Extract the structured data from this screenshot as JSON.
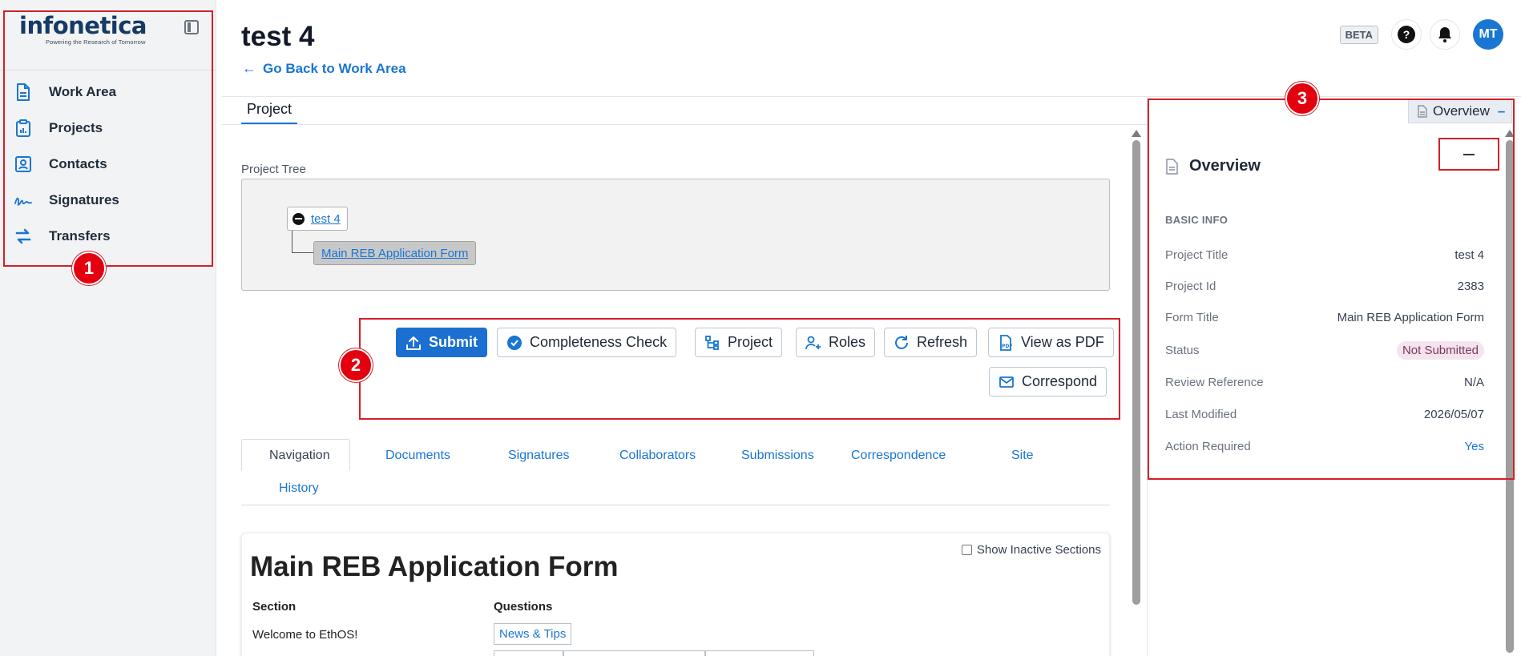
{
  "brand": {
    "name": "infonetica",
    "tagline": "Powering the Research of Tomorrow"
  },
  "sidebar": {
    "items": [
      {
        "label": "Work Area",
        "icon": "document-icon"
      },
      {
        "label": "Projects",
        "icon": "clipboard-chart-icon"
      },
      {
        "label": "Contacts",
        "icon": "contact-card-icon"
      },
      {
        "label": "Signatures",
        "icon": "signature-icon"
      },
      {
        "label": "Transfers",
        "icon": "transfer-arrows-icon"
      }
    ]
  },
  "header": {
    "title": "test 4",
    "back_label": "Go Back to Work Area",
    "beta": "BETA",
    "help": "?",
    "avatar_initials": "MT"
  },
  "main": {
    "tab_label": "Project",
    "tree_label": "Project Tree",
    "tree": {
      "root": "test 4",
      "child": "Main REB Application Form"
    },
    "actions": {
      "submit": "Submit",
      "completeness": "Completeness Check",
      "project": "Project",
      "roles": "Roles",
      "refresh": "Refresh",
      "pdf": "View as PDF",
      "correspond": "Correspond"
    },
    "tabs": [
      "Navigation",
      "Documents",
      "Signatures",
      "Collaborators",
      "Submissions",
      "Correspondence",
      "Site",
      "History"
    ],
    "form": {
      "title": "Main REB Application Form",
      "show_inactive": "Show Inactive Sections",
      "col_section": "Section",
      "col_questions": "Questions",
      "row1_section": "Welcome to EthOS!",
      "row1_question": "News & Tips"
    }
  },
  "panel": {
    "tab_label": "Overview",
    "title": "Overview",
    "section": "BASIC INFO",
    "rows": [
      {
        "key": "Project Title",
        "value": "test 4"
      },
      {
        "key": "Project Id",
        "value": "2383"
      },
      {
        "key": "Form Title",
        "value": "Main REB Application Form"
      },
      {
        "key": "Status",
        "value": "Not Submitted"
      },
      {
        "key": "Review Reference",
        "value": "N/A"
      },
      {
        "key": "Last Modified",
        "value": "2026/05/07"
      },
      {
        "key": "Action Required",
        "value": "Yes"
      }
    ]
  },
  "annotations": [
    "1",
    "2",
    "3"
  ],
  "colors": {
    "accent": "#1976d2",
    "annotation": "#e3000f",
    "primary_button": "#1a6fd1"
  }
}
